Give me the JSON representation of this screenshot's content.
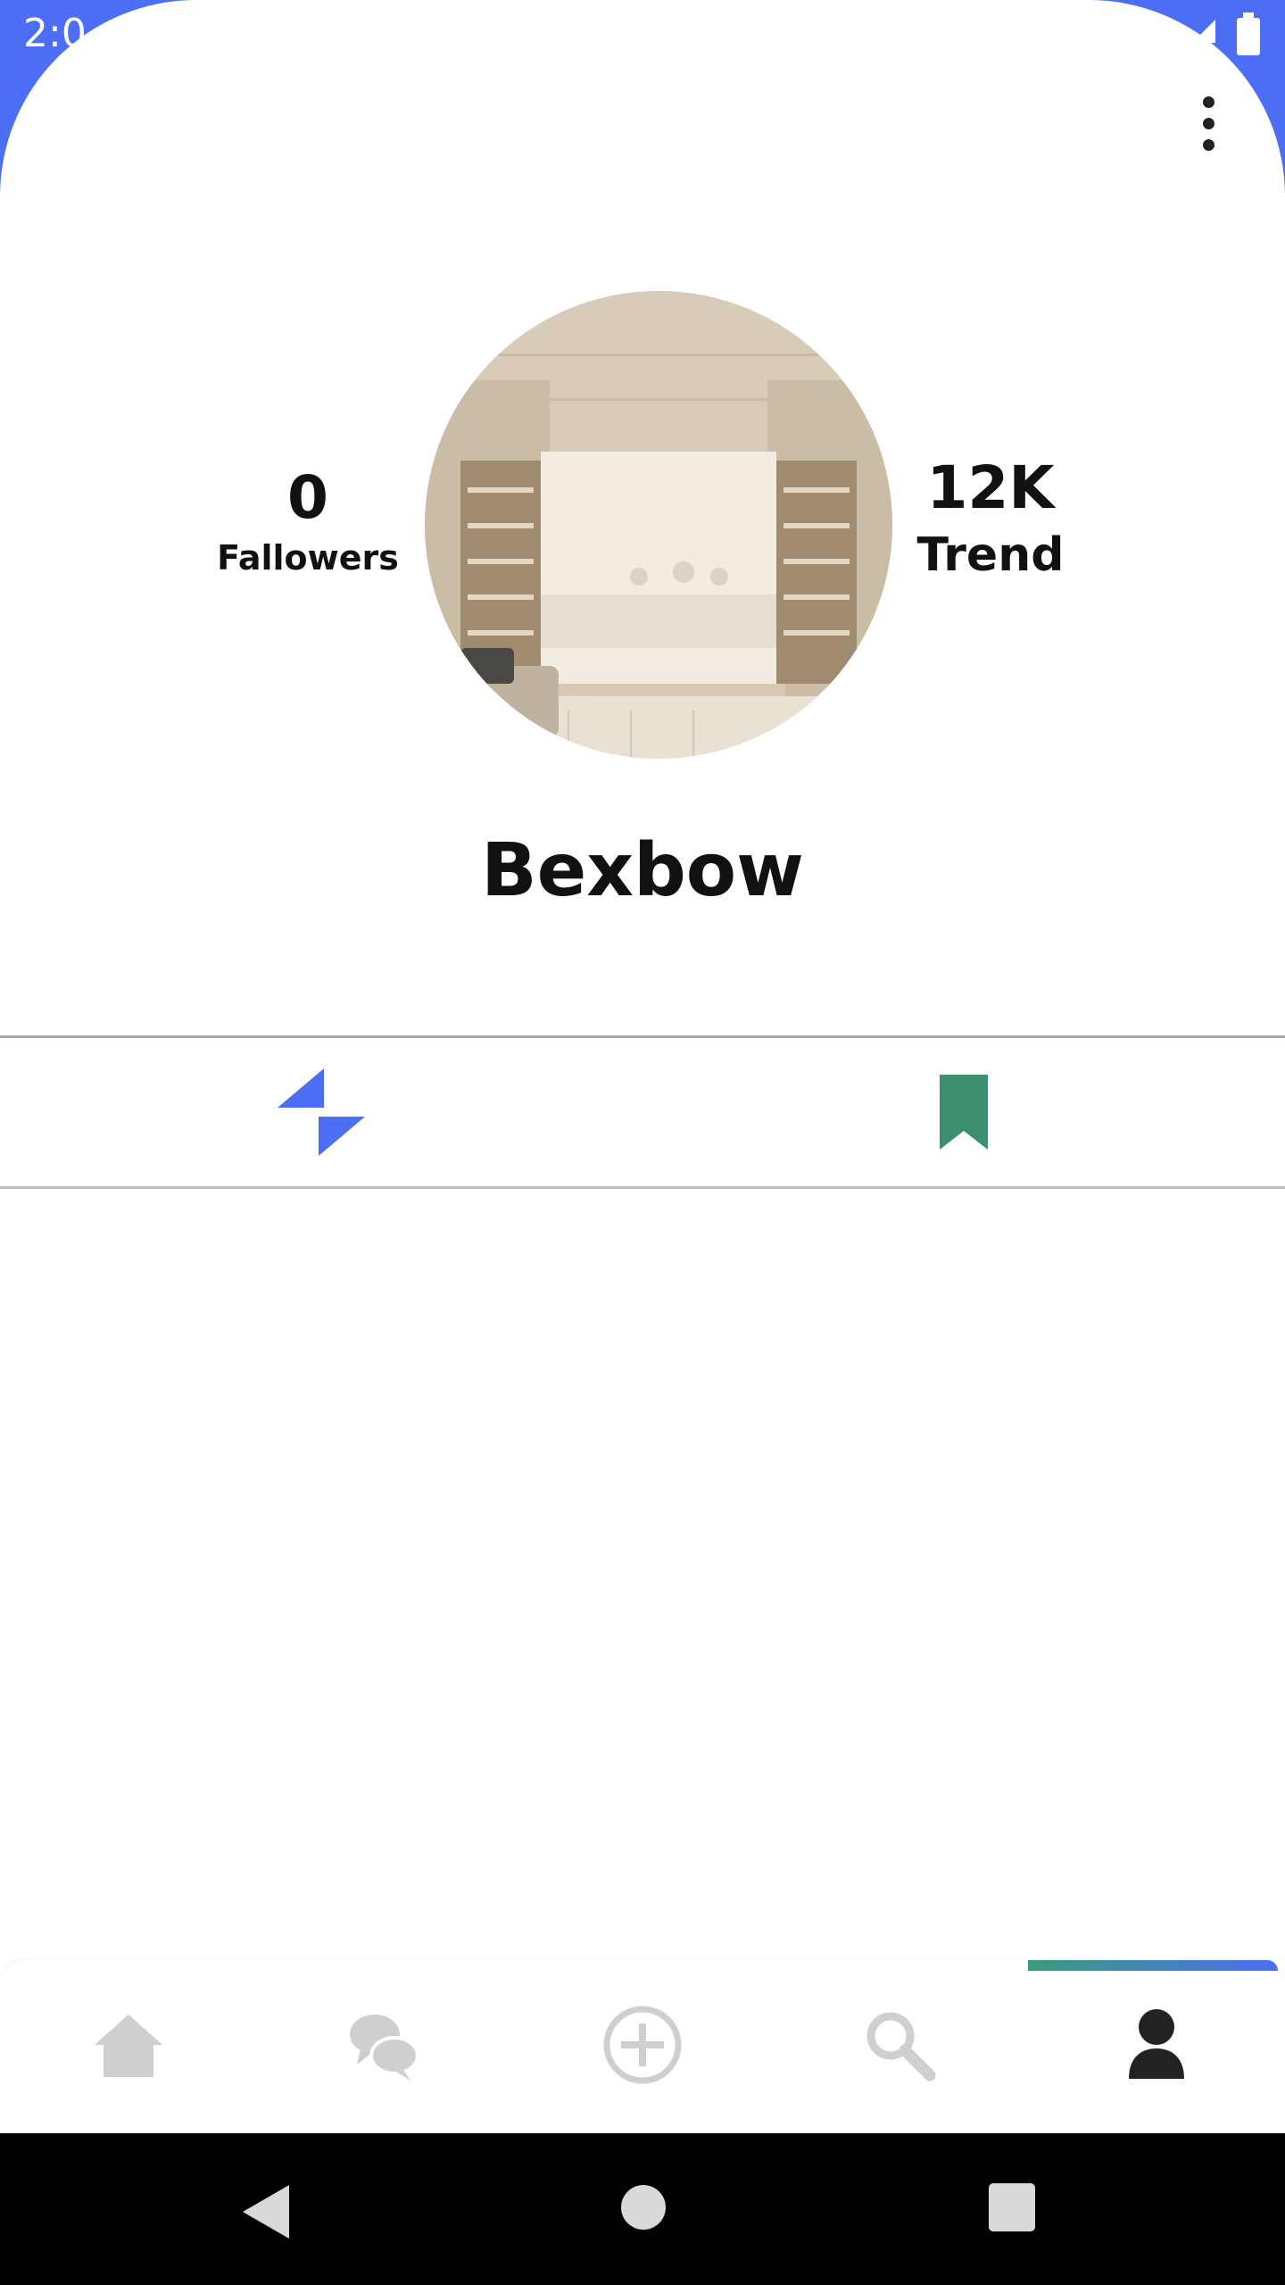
{
  "status_bar": {
    "time": "2:0"
  },
  "profile": {
    "username": "Bexbow",
    "followers_count": "0",
    "followers_label": "Fallowers",
    "trend_count": "12K",
    "trend_label": "Trend"
  },
  "tabs": [
    {
      "name": "posts",
      "icon": "bolt-icon",
      "color": "#4c6ef5",
      "selected": true
    },
    {
      "name": "saved",
      "icon": "bookmark-icon",
      "color": "#3d8f6f",
      "selected": false
    }
  ],
  "bottom_nav": {
    "items": [
      {
        "name": "home",
        "icon": "home-icon"
      },
      {
        "name": "messages",
        "icon": "chat-bubbles-icon"
      },
      {
        "name": "create",
        "icon": "add-circle-icon"
      },
      {
        "name": "search",
        "icon": "search-icon"
      },
      {
        "name": "profile",
        "icon": "person-icon",
        "active": true
      }
    ],
    "active_color": "#222222",
    "inactive_color": "#cfcfcf",
    "indicator_gradient": [
      "#3a9c7c",
      "#4c6ef5"
    ]
  },
  "colors": {
    "accent": "#4c6ef5",
    "bookmark": "#3d8f6f",
    "text": "#111111"
  }
}
